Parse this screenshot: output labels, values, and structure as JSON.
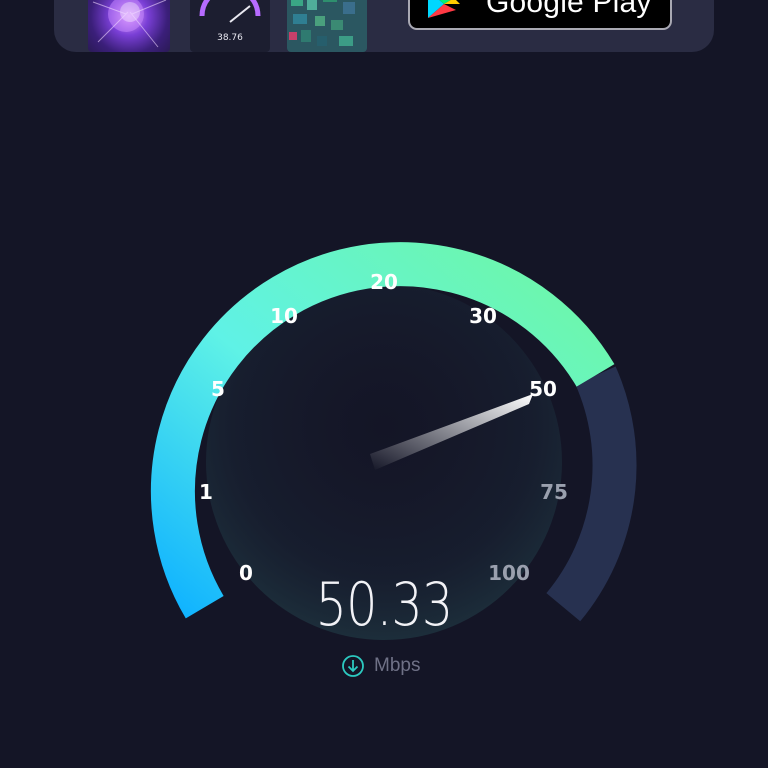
{
  "promo": {
    "thumbnails": [
      "Visualization app preview",
      "Speedtest app preview",
      "Coverage map app preview"
    ],
    "thumb_speed_readout": "38.76",
    "store_button_label": "Google Play"
  },
  "gauge": {
    "scale_labels": [
      "0",
      "1",
      "5",
      "10",
      "20",
      "30",
      "50",
      "75",
      "100"
    ],
    "max_label": "100",
    "needle_value": 50.33,
    "colors": {
      "arc_start": "#10b3ff",
      "arc_mid": "#5ff2e6",
      "arc_end": "#6ff7a3",
      "arc_track": "#273150",
      "active_label": "#ffffff",
      "inactive_label": "#9aa0ae"
    }
  },
  "result": {
    "speed": "50.33",
    "unit": "Mbps",
    "direction_icon": "download-arrow-icon"
  }
}
